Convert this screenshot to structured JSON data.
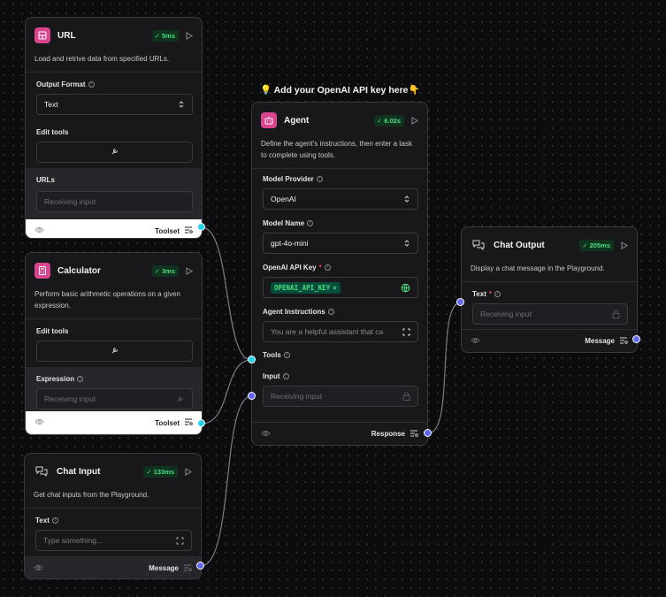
{
  "note": {
    "text": "💡 Add your OpenAI API key here👇"
  },
  "url_node": {
    "title": "URL",
    "time": "5ms",
    "description": "Load and retrive data from specified URLs.",
    "output_format_label": "Output Format",
    "output_format_value": "Text",
    "edit_tools_label": "Edit tools",
    "urls_label": "URLs",
    "urls_placeholder": "Receiving input",
    "footer_label": "Toolset"
  },
  "calc_node": {
    "title": "Calculator",
    "time": "3ms",
    "description": "Perform basic arithmetic operations on a given expression.",
    "edit_tools_label": "Edit tools",
    "expression_label": "Expression",
    "expression_placeholder": "Receiving input",
    "footer_label": "Toolset"
  },
  "chat_input_node": {
    "title": "Chat Input",
    "time": "133ms",
    "description": "Get chat inputs from the Playground.",
    "text_label": "Text",
    "text_placeholder": "Type something...",
    "footer_label": "Message"
  },
  "agent_node": {
    "title": "Agent",
    "time": "6.02s",
    "description": "Define the agent's instructions, then enter a task to complete using tools.",
    "model_provider_label": "Model Provider",
    "model_provider_value": "OpenAI",
    "model_name_label": "Model Name",
    "model_name_value": "gpt-4o-mini",
    "api_key_label": "OpenAI API Key",
    "api_key_value": "OPENAI_API_KEY",
    "instructions_label": "Agent Instructions",
    "instructions_value": "You are a helpful assistant that ca",
    "tools_label": "Tools",
    "input_label": "Input",
    "input_placeholder": "Receiving input",
    "footer_label": "Response"
  },
  "chat_output_node": {
    "title": "Chat Output",
    "time": "205ms",
    "description": "Display a chat message in the Playground.",
    "text_label": "Text",
    "text_placeholder": "Receiving input",
    "footer_label": "Message"
  },
  "colors": {
    "accent_pink": "#d9468f",
    "success": "#4ade80",
    "handle_blue": "#6366f1",
    "handle_cyan": "#22d3ee"
  }
}
